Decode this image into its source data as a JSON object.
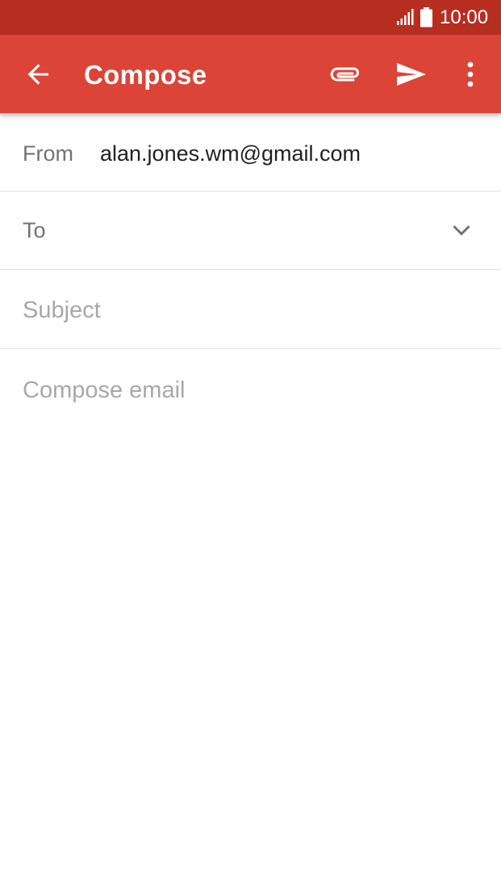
{
  "status_bar": {
    "time": "10:00",
    "signal_icon": "signal-icon",
    "battery_icon": "battery-icon",
    "background": "#b72e21"
  },
  "app_bar": {
    "title": "Compose",
    "background": "#db4437",
    "back_icon": "back-arrow-icon",
    "attach_icon": "paperclip-icon",
    "send_icon": "send-icon",
    "more_icon": "more-vert-icon"
  },
  "form": {
    "from_label": "From",
    "from_value": "alan.jones.wm@gmail.com",
    "to_label": "To",
    "to_value": "",
    "to_chevron_icon": "chevron-down-icon",
    "subject_value": "",
    "subject_placeholder": "Subject",
    "body_value": "",
    "body_placeholder": "Compose email"
  }
}
